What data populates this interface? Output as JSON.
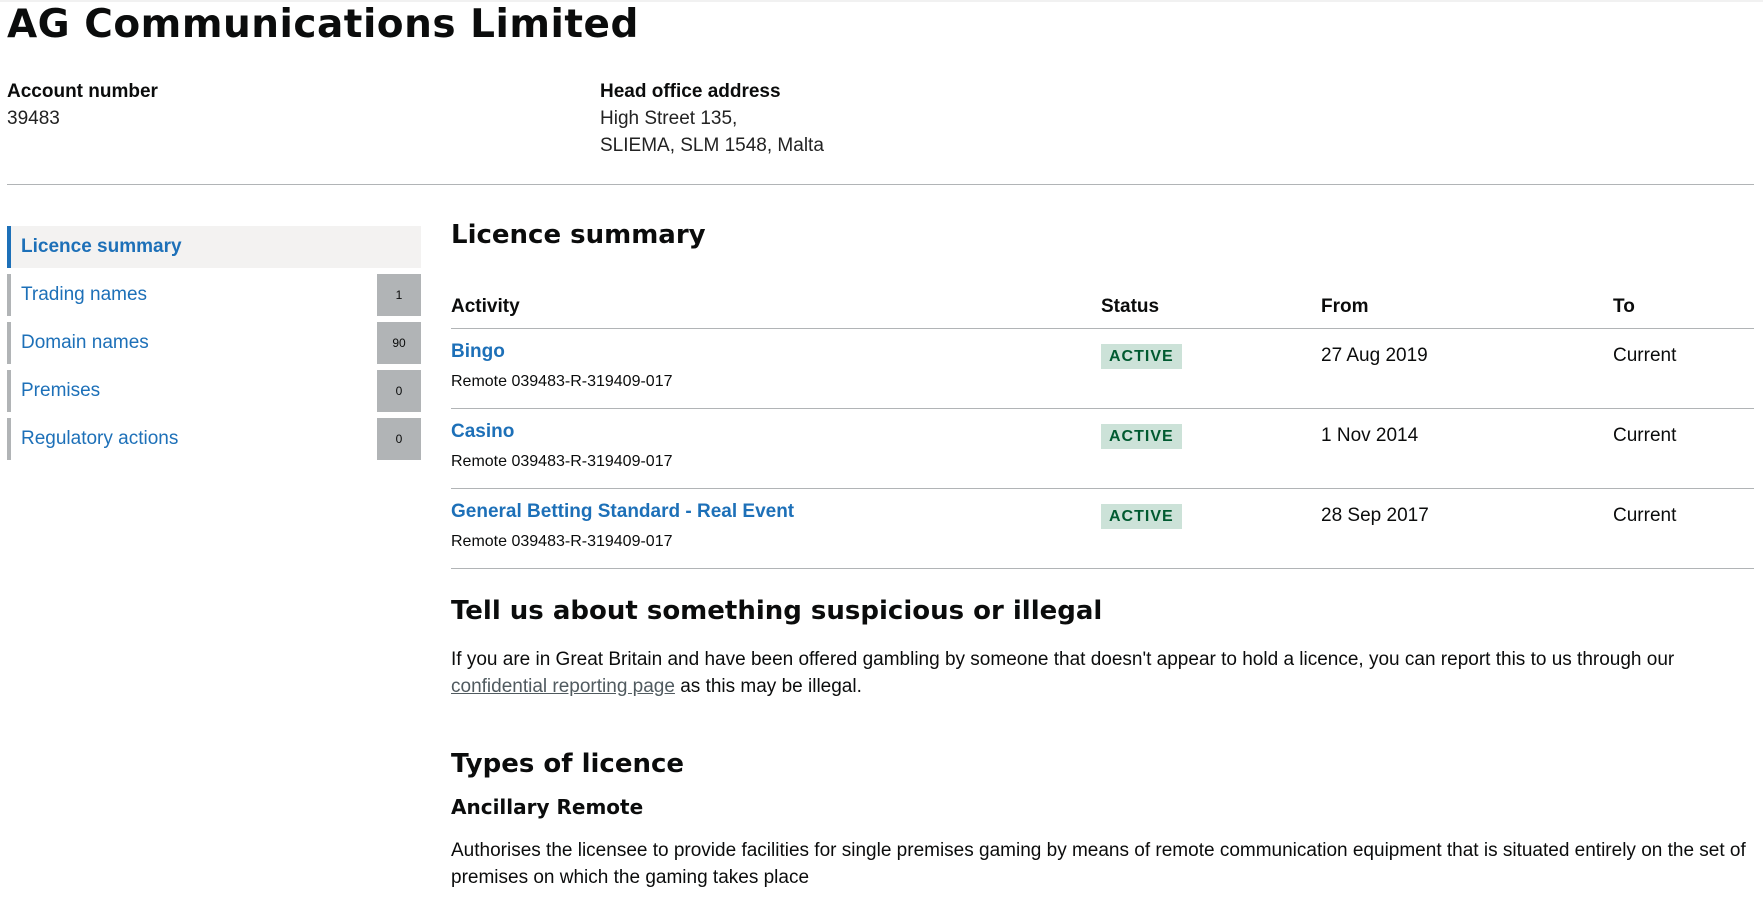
{
  "company_name": "AG Communications Limited",
  "account": {
    "label": "Account number",
    "value": "39483"
  },
  "head_office": {
    "label": "Head office address",
    "line1": "High Street 135,",
    "line2": "SLIEMA, SLM 1548, Malta"
  },
  "sidebar": {
    "items": [
      {
        "label": "Licence summary",
        "count": "",
        "active": true
      },
      {
        "label": "Trading names",
        "count": "1"
      },
      {
        "label": "Domain names",
        "count": "90"
      },
      {
        "label": "Premises",
        "count": "0"
      },
      {
        "label": "Regulatory actions",
        "count": "0"
      }
    ]
  },
  "licence_summary": {
    "heading": "Licence summary",
    "columns": {
      "activity": "Activity",
      "status": "Status",
      "from": "From",
      "to": "To"
    },
    "rows": [
      {
        "activity": "Bingo",
        "reference": "Remote 039483-R-319409-017",
        "status": "ACTIVE",
        "from": "27 Aug 2019",
        "to": "Current"
      },
      {
        "activity": "Casino",
        "reference": "Remote 039483-R-319409-017",
        "status": "ACTIVE",
        "from": "1 Nov 2014",
        "to": "Current"
      },
      {
        "activity": "General Betting Standard - Real Event",
        "reference": "Remote 039483-R-319409-017",
        "status": "ACTIVE",
        "from": "28 Sep 2017",
        "to": "Current"
      }
    ]
  },
  "report": {
    "heading": "Tell us about something suspicious or illegal",
    "text_before": "If you are in Great Britain and have been offered gambling by someone that doesn't appear to hold a licence, you can report this to us through our",
    "link_text": "confidential reporting page",
    "text_after": "as this may be illegal."
  },
  "types": {
    "heading": "Types of licence",
    "subheading": "Ancillary Remote",
    "description": "Authorises the licensee to provide facilities for single premises gaming by means of remote communication equipment that is situated entirely on the set of premises on which the gaming takes place"
  },
  "colors": {
    "link": "#1d70b8",
    "badge_bg": "#cce2d8",
    "badge_text": "#005a30",
    "count_bg": "#b1b4b6"
  }
}
